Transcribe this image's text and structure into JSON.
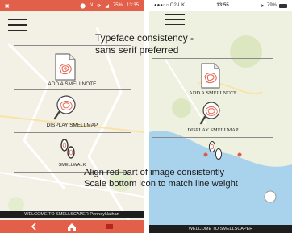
{
  "left_phone": {
    "status_bar": {
      "time": "13:35",
      "battery": "75%"
    },
    "menu": {
      "add_label": "ADD A SMELLNOTE",
      "display_label": "DISPLAY SMELLMAP",
      "walk_label": "SMELLWALK"
    },
    "welcome": "WELCOME TO SMELLSCAPER PenneyNathan",
    "nav_icons": [
      "chevron-left-icon",
      "home-icon",
      "note-icon"
    ]
  },
  "right_phone": {
    "status_bar": {
      "carrier": "●●●○○ O2-UK",
      "time": "13:55",
      "battery": "79%"
    },
    "menu": {
      "add_label": "ADD A SMELLNOTE",
      "display_label": "DISPLAY SMELLMAP"
    },
    "welcome": "WELCOME TO SMELLSCAPER"
  },
  "annotations": {
    "typeface_line1": "Typeface consistency -",
    "typeface_line2": "sans serif preferred",
    "align_line": "Align red part of image consistently",
    "scale_line": "Scale bottom icon to match line weight"
  },
  "colors": {
    "accent": "#e2604a",
    "map_land": "#eef1df",
    "map_water": "#a9d2ec"
  }
}
